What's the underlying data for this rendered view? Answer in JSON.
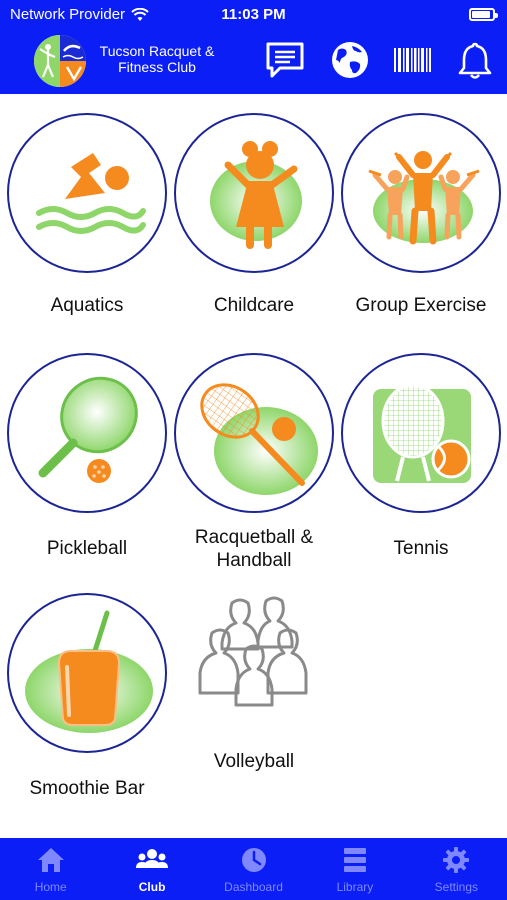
{
  "status_bar": {
    "carrier": "Network Provider",
    "time": "11:03 PM"
  },
  "header": {
    "club_name_line1": "Tucson Racquet &",
    "club_name_line2": "Fitness Club",
    "icons": [
      "chat-icon",
      "globe-icon",
      "barcode-icon",
      "bell-icon"
    ]
  },
  "tiles": [
    {
      "label": "Aquatics",
      "icon": "swimmer-icon"
    },
    {
      "label": "Childcare",
      "icon": "child-icon"
    },
    {
      "label": "Group Exercise",
      "icon": "group-exercise-icon"
    },
    {
      "label": "Pickleball",
      "icon": "pickleball-icon"
    },
    {
      "label_line1": "Racquetball &",
      "label_line2": "Handball",
      "icon": "racquetball-icon"
    },
    {
      "label": "Tennis",
      "icon": "tennis-icon"
    },
    {
      "label": "Smoothie Bar",
      "icon": "smoothie-icon"
    },
    {
      "label": "Volleyball",
      "icon": "people-icon"
    }
  ],
  "bottom_nav": {
    "items": [
      {
        "label": "Home",
        "icon": "home-icon"
      },
      {
        "label": "Club",
        "icon": "club-icon",
        "active": true
      },
      {
        "label": "Dashboard",
        "icon": "clock-icon"
      },
      {
        "label": "Library",
        "icon": "library-icon"
      },
      {
        "label": "Settings",
        "icon": "gear-icon"
      }
    ]
  },
  "colors": {
    "brand_blue": "#0b1ef5",
    "accent_orange": "#f58a1f",
    "accent_green": "#8ed66a",
    "circle_border": "#1c2596"
  }
}
